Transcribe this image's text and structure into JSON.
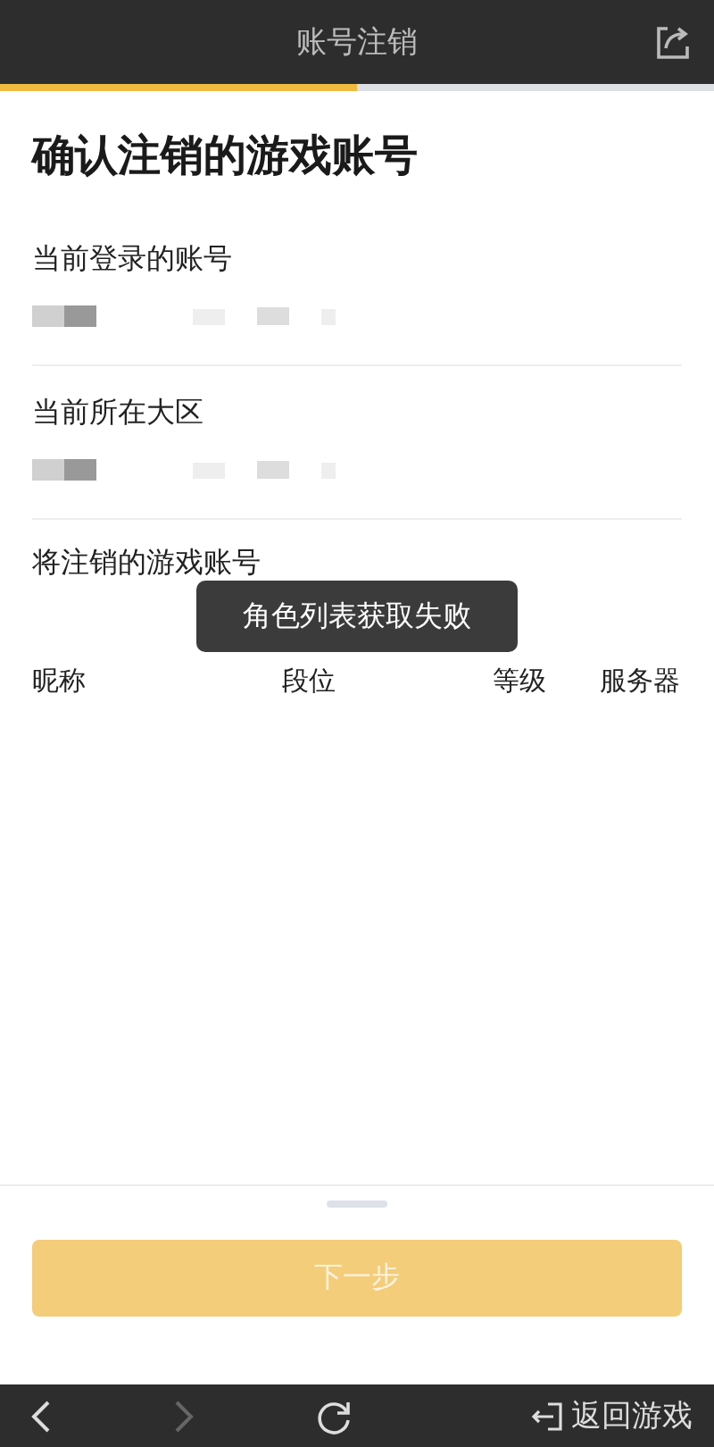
{
  "header": {
    "title": "账号注销",
    "progress": {
      "level": 0.5
    }
  },
  "heading": "确认注销的游戏账号",
  "sections": [
    {
      "label": "当前登录的账号",
      "kind": "redacted"
    },
    {
      "label": "当前所在大区",
      "kind": "redacted"
    }
  ],
  "accounts": {
    "label": "将注销的游戏账号",
    "columns": [
      "昵称",
      "段位",
      "等级",
      "服务器"
    ]
  },
  "toast": "角色列表获取失败",
  "next_button": {
    "label": "下一步",
    "disabled": true
  },
  "bottom_bar": {
    "back": {
      "disabled": false
    },
    "forward": {
      "disabled": true
    },
    "return_label": "返回游戏"
  }
}
